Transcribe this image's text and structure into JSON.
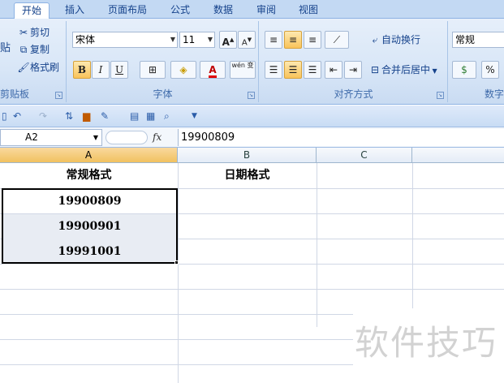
{
  "tabs": [
    "开始",
    "插入",
    "页面布局",
    "公式",
    "数据",
    "审阅",
    "视图"
  ],
  "clipboard": {
    "cut": "剪切",
    "copy": "复制",
    "format_painter": "格式刷",
    "paste_partial": "贴",
    "group_label": "剪贴板"
  },
  "font": {
    "name": "宋体",
    "size": "11",
    "bold": "B",
    "italic": "I",
    "underline": "U",
    "font_color_glyph": "A",
    "phonetic": "wén 变",
    "grow": "A",
    "shrink": "A",
    "group_label": "字体"
  },
  "alignment": {
    "wrap_text": "自动换行",
    "merge_center": "合并后居中",
    "group_label": "对齐方式"
  },
  "number": {
    "format": "常规",
    "percent": "%",
    "group_label_partial": "数字"
  },
  "formula_bar": {
    "name_box": "A2",
    "fx": "fx",
    "content": "19900809"
  },
  "columns": [
    "A",
    "B",
    "C"
  ],
  "cells": {
    "a1": "常规格式",
    "b1": "日期格式",
    "a2": "19900809",
    "a3": "19900901",
    "a4": "19991001"
  },
  "watermark": "软件技巧",
  "colors": {
    "accent": "#15428b",
    "selected_header": "#f1c15f",
    "ribbon": "#d8e6f7"
  }
}
